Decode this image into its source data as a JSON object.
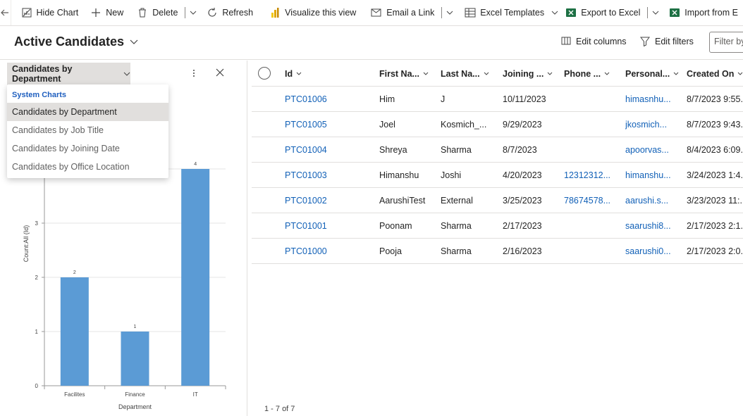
{
  "commandbar": {
    "items": [
      {
        "label": "Hide Chart",
        "icon": "hide-chart-icon"
      },
      {
        "label": "New",
        "icon": "plus-icon"
      },
      {
        "label": "Delete",
        "icon": "trash-icon"
      },
      {
        "label": "Refresh",
        "icon": "refresh-icon"
      },
      {
        "label": "Visualize this view",
        "icon": "power-bi-icon"
      },
      {
        "label": "Email a Link",
        "icon": "email-icon"
      },
      {
        "label": "Excel Templates",
        "icon": "excel-templates-icon"
      },
      {
        "label": "Export to Excel",
        "icon": "excel-icon"
      },
      {
        "label": "Import from E",
        "icon": "excel-import-icon"
      }
    ]
  },
  "view": {
    "title": "Active Candidates",
    "edit_columns": "Edit columns",
    "edit_filters": "Edit filters",
    "filter_placeholder": "Filter by"
  },
  "chart_panel": {
    "selector_label": "Candidates by Department",
    "dropdown": {
      "group_label": "System Charts",
      "items": [
        "Candidates by Department",
        "Candidates by Job Title",
        "Candidates by Joining Date",
        "Candidates by Office Location"
      ],
      "selected_index": 0
    }
  },
  "chart_data": {
    "type": "bar",
    "categories": [
      "Facilites",
      "Finance",
      "IT"
    ],
    "values": [
      2,
      1,
      4
    ],
    "data_labels": [
      "2",
      "1",
      "4"
    ],
    "xlabel": "Department",
    "ylabel": "Count:All (Id)",
    "ylim": [
      0,
      4
    ],
    "yticks": [
      "0",
      "1",
      "2",
      "3"
    ],
    "grid": true,
    "color": "#5b9bd5"
  },
  "grid": {
    "columns": [
      "Id",
      "First Na...",
      "Last Na...",
      "Joining ...",
      "Phone ...",
      "Personal...",
      "Created On"
    ],
    "rows": [
      {
        "id": "PTC01006",
        "first": "Him",
        "last": "J",
        "joining": "10/11/2023",
        "phone": "",
        "personal": "himasnhu...",
        "created": "8/7/2023 9:55..."
      },
      {
        "id": "PTC01005",
        "first": "Joel",
        "last": "Kosmich_...",
        "joining": "9/29/2023",
        "phone": "",
        "personal": "jkosmich...",
        "created": "8/7/2023 9:43..."
      },
      {
        "id": "PTC01004",
        "first": "Shreya",
        "last": "Sharma",
        "joining": "8/7/2023",
        "phone": "",
        "personal": "apoorvas...",
        "created": "8/4/2023 6:09..."
      },
      {
        "id": "PTC01003",
        "first": "Himanshu",
        "last": "Joshi",
        "joining": "4/20/2023",
        "phone": "12312312...",
        "personal": "himanshu...",
        "created": "3/24/2023 1:4..."
      },
      {
        "id": "PTC01002",
        "first": "AarushiTest",
        "last": "External",
        "joining": "3/25/2023",
        "phone": "78674578...",
        "personal": "aarushi.s...",
        "created": "3/23/2023 11:..."
      },
      {
        "id": "PTC01001",
        "first": "Poonam",
        "last": "Sharma",
        "joining": "2/17/2023",
        "phone": "",
        "personal": "saarushi8...",
        "created": "2/17/2023 2:1..."
      },
      {
        "id": "PTC01000",
        "first": "Pooja",
        "last": "Sharma",
        "joining": "2/16/2023",
        "phone": "",
        "personal": "saarushi0...",
        "created": "2/17/2023 2:0..."
      }
    ],
    "pager": "1 - 7 of 7"
  }
}
